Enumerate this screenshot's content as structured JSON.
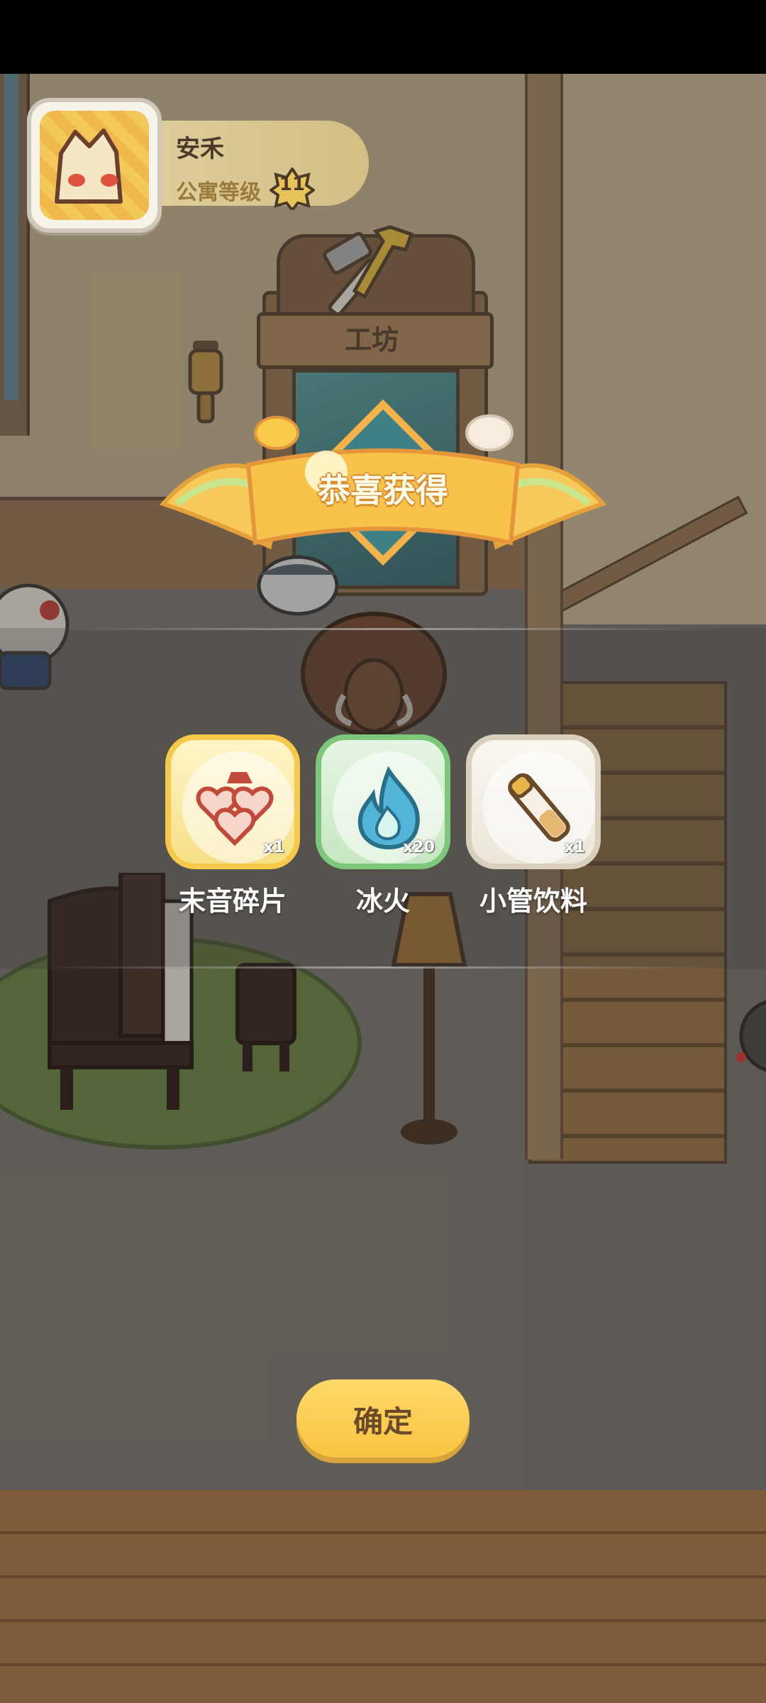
{
  "player": {
    "name": "安禾",
    "apartment_level_label": "公寓等级",
    "apartment_level": "11"
  },
  "scene": {
    "workshop_sign": "工坊"
  },
  "reward_popup": {
    "title": "恭喜获得",
    "items": [
      {
        "name": "末音碎片",
        "count": "x1",
        "rarity": "gold",
        "icon": "hearts-fragment-icon"
      },
      {
        "name": "冰火",
        "count": "x20",
        "rarity": "green",
        "icon": "blue-flame-icon"
      },
      {
        "name": "小管饮料",
        "count": "x1",
        "rarity": "white",
        "icon": "tube-drink-icon"
      }
    ],
    "confirm_label": "确定"
  },
  "colors": {
    "gold_frame": "#f6c94a",
    "green_frame": "#7dc77b",
    "white_frame": "#d9cfbd",
    "button": "#f8c441",
    "button_text": "#6b4a2a"
  }
}
